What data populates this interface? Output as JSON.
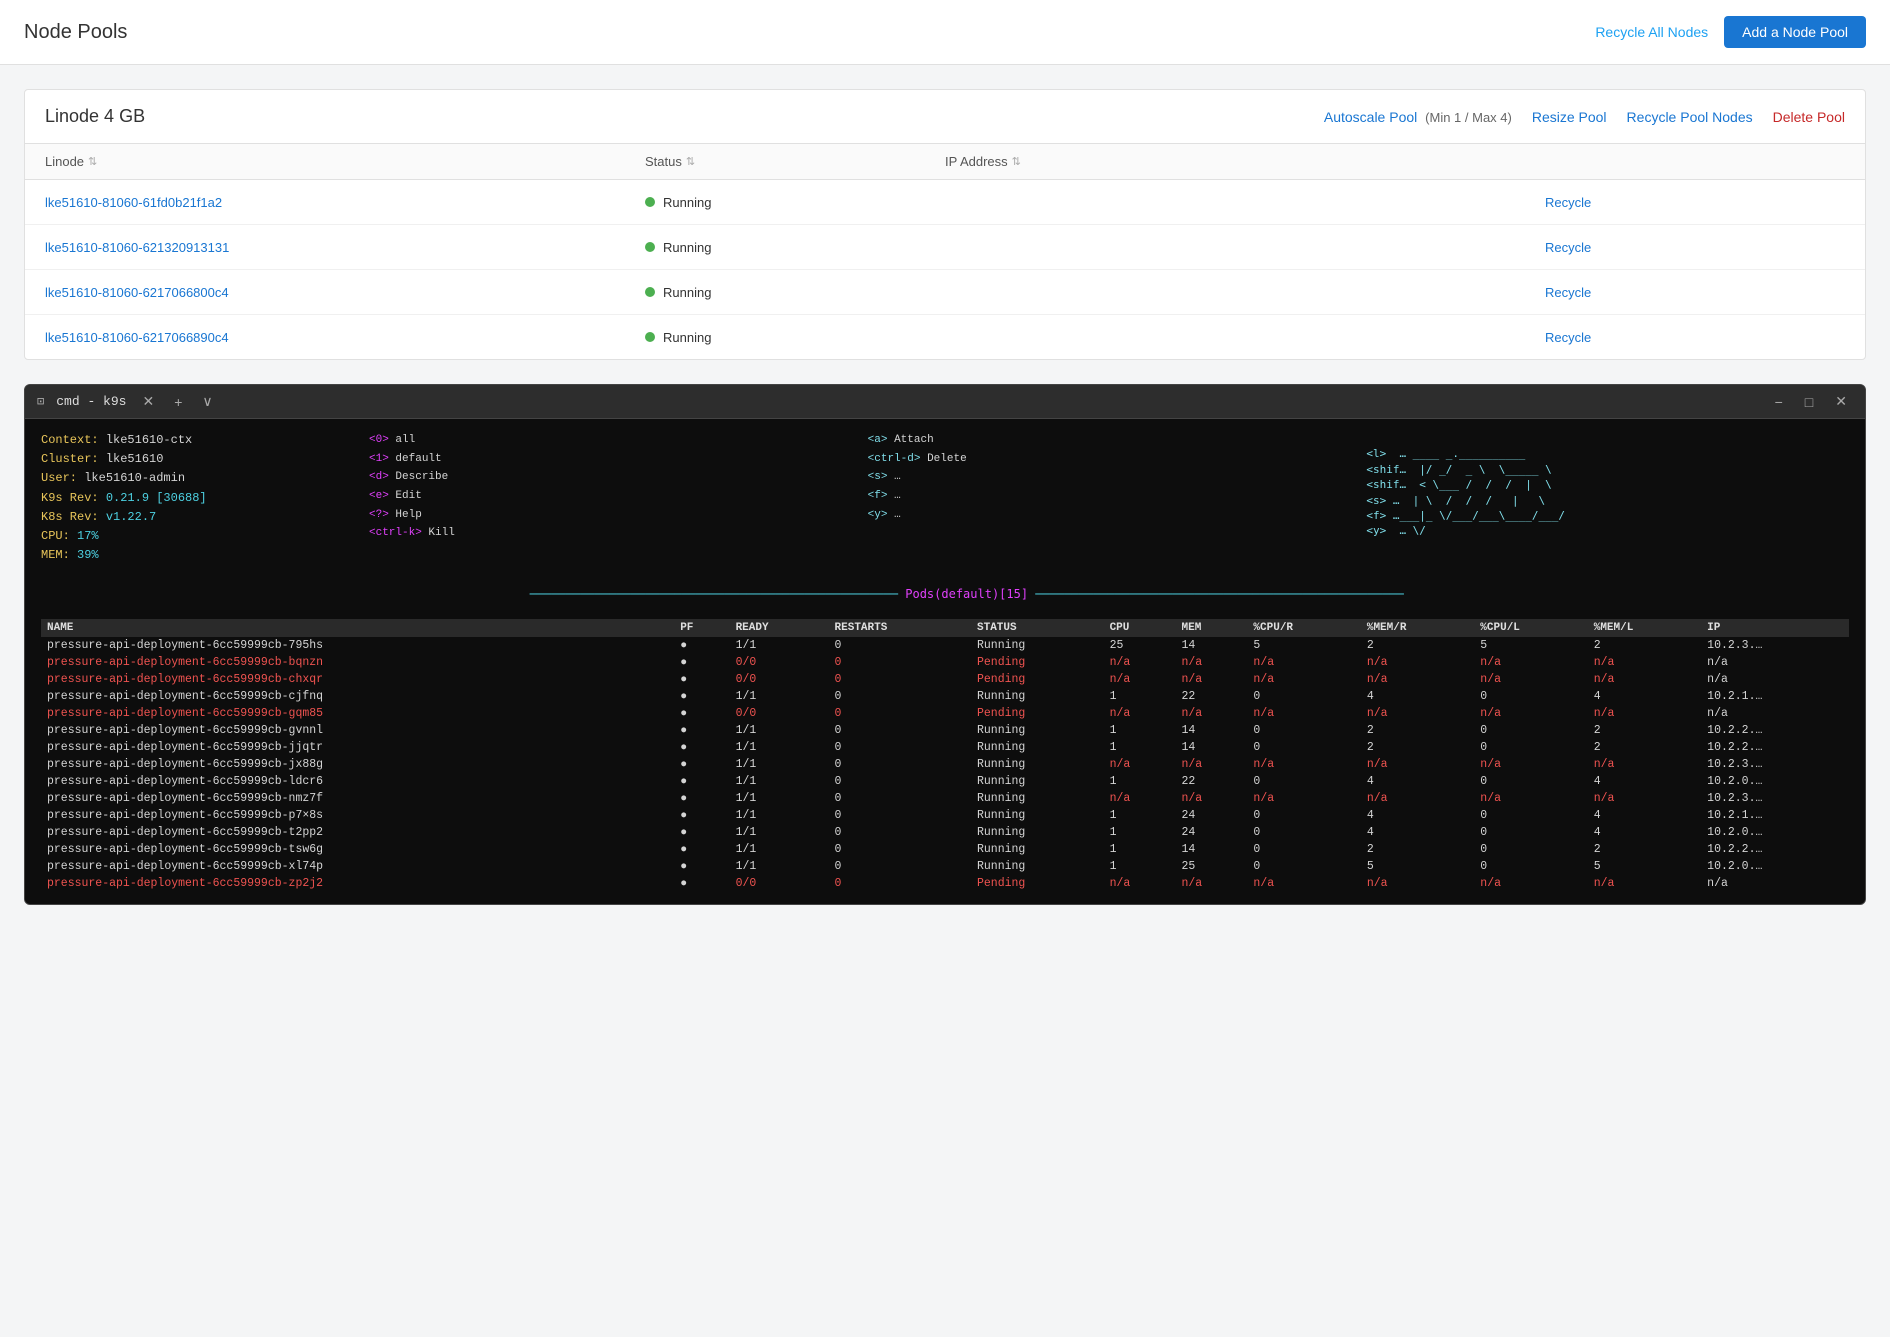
{
  "header": {
    "title": "Node Pools",
    "recycle_all_label": "Recycle All Nodes",
    "add_pool_label": "Add a Node Pool"
  },
  "pool": {
    "name": "Linode 4 GB",
    "autoscale_label": "Autoscale Pool",
    "autoscale_meta": "(Min 1 / Max 4)",
    "resize_label": "Resize Pool",
    "recycle_label": "Recycle Pool Nodes",
    "delete_label": "Delete Pool",
    "table": {
      "col_linode": "Linode",
      "col_status": "Status",
      "col_ip": "IP Address",
      "col_action": "",
      "rows": [
        {
          "name": "lke51610-81060-61fd0b21f1a2",
          "status": "Running",
          "recycle": "Recycle"
        },
        {
          "name": "lke51610-81060-621320913131",
          "status": "Running",
          "recycle": "Recycle"
        },
        {
          "name": "lke51610-81060-6217066800c4",
          "status": "Running",
          "recycle": "Recycle"
        },
        {
          "name": "lke51610-81060-6217066890c4",
          "status": "Running",
          "recycle": "Recycle"
        }
      ]
    }
  },
  "terminal": {
    "title": "cmd - k9s",
    "info": {
      "context_label": "Context:",
      "context_val": "lke51610-ctx",
      "cluster_label": "Cluster:",
      "cluster_val": "lke51610",
      "user_label": "User:",
      "user_val": "lke51610-admin",
      "k9s_rev_label": "K9s Rev:",
      "k9s_rev_val": "0.21.9 [30688]",
      "k8s_rev_label": "K8s Rev:",
      "k8s_rev_val": "v1.22.7",
      "cpu_label": "CPU:",
      "cpu_val": "17%",
      "mem_label": "MEM:",
      "mem_val": "39%"
    },
    "shortcuts": [
      {
        "key": "<0>",
        "action": "all"
      },
      {
        "key": "<1>",
        "action": "default"
      },
      {
        "key": "<d>",
        "action": "Describe"
      },
      {
        "key": "<e>",
        "action": "Edit"
      },
      {
        "key": "<?>",
        "action": "Help"
      },
      {
        "key": "<ctrl-k>",
        "action": "Kill"
      },
      {
        "key": "<a>",
        "action": "Attach"
      },
      {
        "key": "<ctrl-d>",
        "action": "Delete"
      },
      {
        "key": "<s>",
        "action": "..."
      },
      {
        "key": "<f>",
        "action": "..."
      },
      {
        "key": "<y>",
        "action": "..."
      },
      {
        "key": "<l>",
        "action": "…"
      },
      {
        "key": "<shif…",
        "action": ""
      },
      {
        "key": "<shif…",
        "action": ""
      },
      {
        "key": "<s>",
        "action": "…"
      }
    ],
    "divider_title": "Pods(default)[15]",
    "pods_table": {
      "headers": [
        "NAME",
        "PF",
        "READY",
        "RESTARTS",
        "STATUS",
        "CPU",
        "MEM",
        "%CPU/R",
        "%MEM/R",
        "%CPU/L",
        "%MEM/L",
        "IP"
      ],
      "rows": [
        {
          "name": "pressure-api-deployment-6cc59999cb-795hs",
          "pf": "●",
          "ready": "1/1",
          "restarts": "0",
          "status": "Running",
          "cpu": "25",
          "mem": "14",
          "cpuR": "5",
          "memR": "2",
          "cpuL": "5",
          "memL": "2",
          "ip": "10.2.3.…",
          "pending": false
        },
        {
          "name": "pressure-api-deployment-6cc59999cb-bqnzn",
          "pf": "●",
          "ready": "0/0",
          "restarts": "0",
          "status": "Pending",
          "cpu": "n/a",
          "mem": "n/a",
          "cpuR": "n/a",
          "memR": "n/a",
          "cpuL": "n/a",
          "memL": "n/a",
          "ip": "n/a",
          "pending": true
        },
        {
          "name": "pressure-api-deployment-6cc59999cb-chxqr",
          "pf": "●",
          "ready": "0/0",
          "restarts": "0",
          "status": "Pending",
          "cpu": "n/a",
          "mem": "n/a",
          "cpuR": "n/a",
          "memR": "n/a",
          "cpuL": "n/a",
          "memL": "n/a",
          "ip": "n/a",
          "pending": true
        },
        {
          "name": "pressure-api-deployment-6cc59999cb-cjfnq",
          "pf": "●",
          "ready": "1/1",
          "restarts": "0",
          "status": "Running",
          "cpu": "1",
          "mem": "22",
          "cpuR": "0",
          "memR": "4",
          "cpuL": "0",
          "memL": "4",
          "ip": "10.2.1.…",
          "pending": false
        },
        {
          "name": "pressure-api-deployment-6cc59999cb-gqm85",
          "pf": "●",
          "ready": "0/0",
          "restarts": "0",
          "status": "Pending",
          "cpu": "n/a",
          "mem": "n/a",
          "cpuR": "n/a",
          "memR": "n/a",
          "cpuL": "n/a",
          "memL": "n/a",
          "ip": "n/a",
          "pending": true
        },
        {
          "name": "pressure-api-deployment-6cc59999cb-gvnnl",
          "pf": "●",
          "ready": "1/1",
          "restarts": "0",
          "status": "Running",
          "cpu": "1",
          "mem": "14",
          "cpuR": "0",
          "memR": "2",
          "cpuL": "0",
          "memL": "2",
          "ip": "10.2.2.…",
          "pending": false
        },
        {
          "name": "pressure-api-deployment-6cc59999cb-jjqtr",
          "pf": "●",
          "ready": "1/1",
          "restarts": "0",
          "status": "Running",
          "cpu": "1",
          "mem": "14",
          "cpuR": "0",
          "memR": "2",
          "cpuL": "0",
          "memL": "2",
          "ip": "10.2.2.…",
          "pending": false
        },
        {
          "name": "pressure-api-deployment-6cc59999cb-jx88g",
          "pf": "●",
          "ready": "1/1",
          "restarts": "0",
          "status": "Running",
          "cpu": "n/a",
          "mem": "n/a",
          "cpuR": "n/a",
          "memR": "n/a",
          "cpuL": "n/a",
          "memL": "n/a",
          "ip": "10.2.3.…",
          "pending": false
        },
        {
          "name": "pressure-api-deployment-6cc59999cb-ldcr6",
          "pf": "●",
          "ready": "1/1",
          "restarts": "0",
          "status": "Running",
          "cpu": "1",
          "mem": "22",
          "cpuR": "0",
          "memR": "4",
          "cpuL": "0",
          "memL": "4",
          "ip": "10.2.0.…",
          "pending": false
        },
        {
          "name": "pressure-api-deployment-6cc59999cb-nmz7f",
          "pf": "●",
          "ready": "1/1",
          "restarts": "0",
          "status": "Running",
          "cpu": "n/a",
          "mem": "n/a",
          "cpuR": "n/a",
          "memR": "n/a",
          "cpuL": "n/a",
          "memL": "n/a",
          "ip": "10.2.3.…",
          "pending": false
        },
        {
          "name": "pressure-api-deployment-6cc59999cb-p7×8s",
          "pf": "●",
          "ready": "1/1",
          "restarts": "0",
          "status": "Running",
          "cpu": "1",
          "mem": "24",
          "cpuR": "0",
          "memR": "4",
          "cpuL": "0",
          "memL": "4",
          "ip": "10.2.1.…",
          "pending": false
        },
        {
          "name": "pressure-api-deployment-6cc59999cb-t2pp2",
          "pf": "●",
          "ready": "1/1",
          "restarts": "0",
          "status": "Running",
          "cpu": "1",
          "mem": "24",
          "cpuR": "0",
          "memR": "4",
          "cpuL": "0",
          "memL": "4",
          "ip": "10.2.0.…",
          "pending": false
        },
        {
          "name": "pressure-api-deployment-6cc59999cb-tsw6g",
          "pf": "●",
          "ready": "1/1",
          "restarts": "0",
          "status": "Running",
          "cpu": "1",
          "mem": "14",
          "cpuR": "0",
          "memR": "2",
          "cpuL": "0",
          "memL": "2",
          "ip": "10.2.2.…",
          "pending": false
        },
        {
          "name": "pressure-api-deployment-6cc59999cb-xl74p",
          "pf": "●",
          "ready": "1/1",
          "restarts": "0",
          "status": "Running",
          "cpu": "1",
          "mem": "25",
          "cpuR": "0",
          "memR": "5",
          "cpuL": "0",
          "memL": "5",
          "ip": "10.2.0.…",
          "pending": false
        },
        {
          "name": "pressure-api-deployment-6cc59999cb-zp2j2",
          "pf": "●",
          "ready": "0/0",
          "restarts": "0",
          "status": "Pending",
          "cpu": "n/a",
          "mem": "n/a",
          "cpuR": "n/a",
          "memR": "n/a",
          "cpuL": "n/a",
          "memL": "n/a",
          "ip": "n/a",
          "pending": true
        }
      ]
    }
  }
}
